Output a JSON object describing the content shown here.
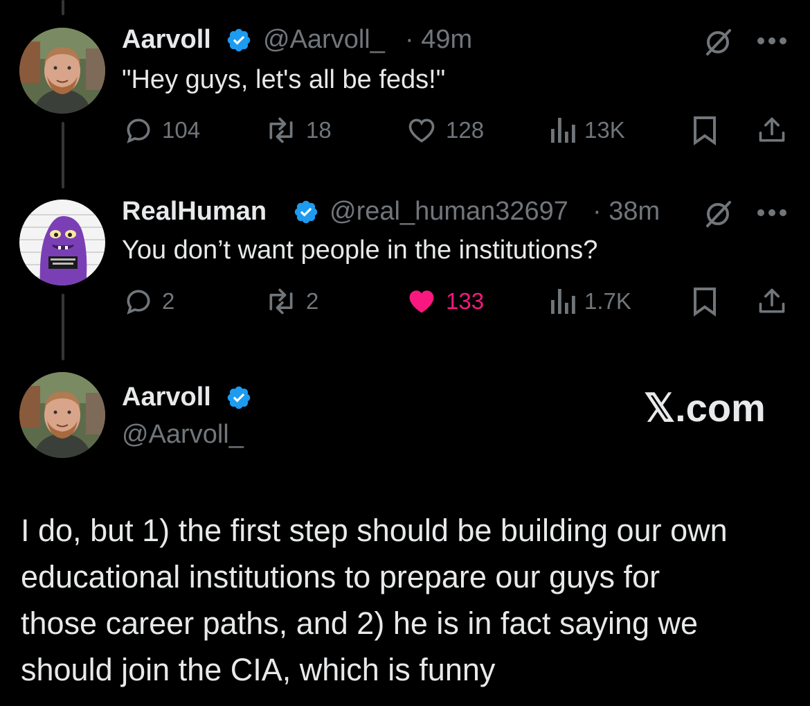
{
  "tweet1": {
    "name": "Aarvoll",
    "handle": "@Aarvoll_",
    "time": "· 49m",
    "text": "\"Hey guys, let's all be feds!\"",
    "replies": "104",
    "reposts": "18",
    "likes": "128",
    "views": "13K",
    "liked": false
  },
  "tweet2": {
    "name": "RealHuman",
    "handle": "@real_human32697",
    "time": "· 38m",
    "text": "You don’t want people in the institutions?",
    "replies": "2",
    "reposts": "2",
    "likes": "133",
    "views": "1.7K",
    "liked": true
  },
  "main": {
    "name": "Aarvoll",
    "handle": "@Aarvoll_",
    "brand": "𝕏.com",
    "lines": [
      "I do, but 1) the first step should be building our own",
      "educational institutions to prepare our guys for",
      "those career paths, and 2) he is in fact saying we",
      "should join the CIA, which is funny"
    ]
  },
  "colors": {
    "background": "#000000",
    "text": "#e7e9ea",
    "secondary": "#71767b",
    "verified": "#1d9bf0",
    "like_active": "#f91880"
  },
  "icons": [
    "verified-badge-icon",
    "grok-icon",
    "more-icon",
    "reply-icon",
    "repost-icon",
    "like-icon",
    "views-icon",
    "bookmark-icon",
    "share-icon"
  ]
}
